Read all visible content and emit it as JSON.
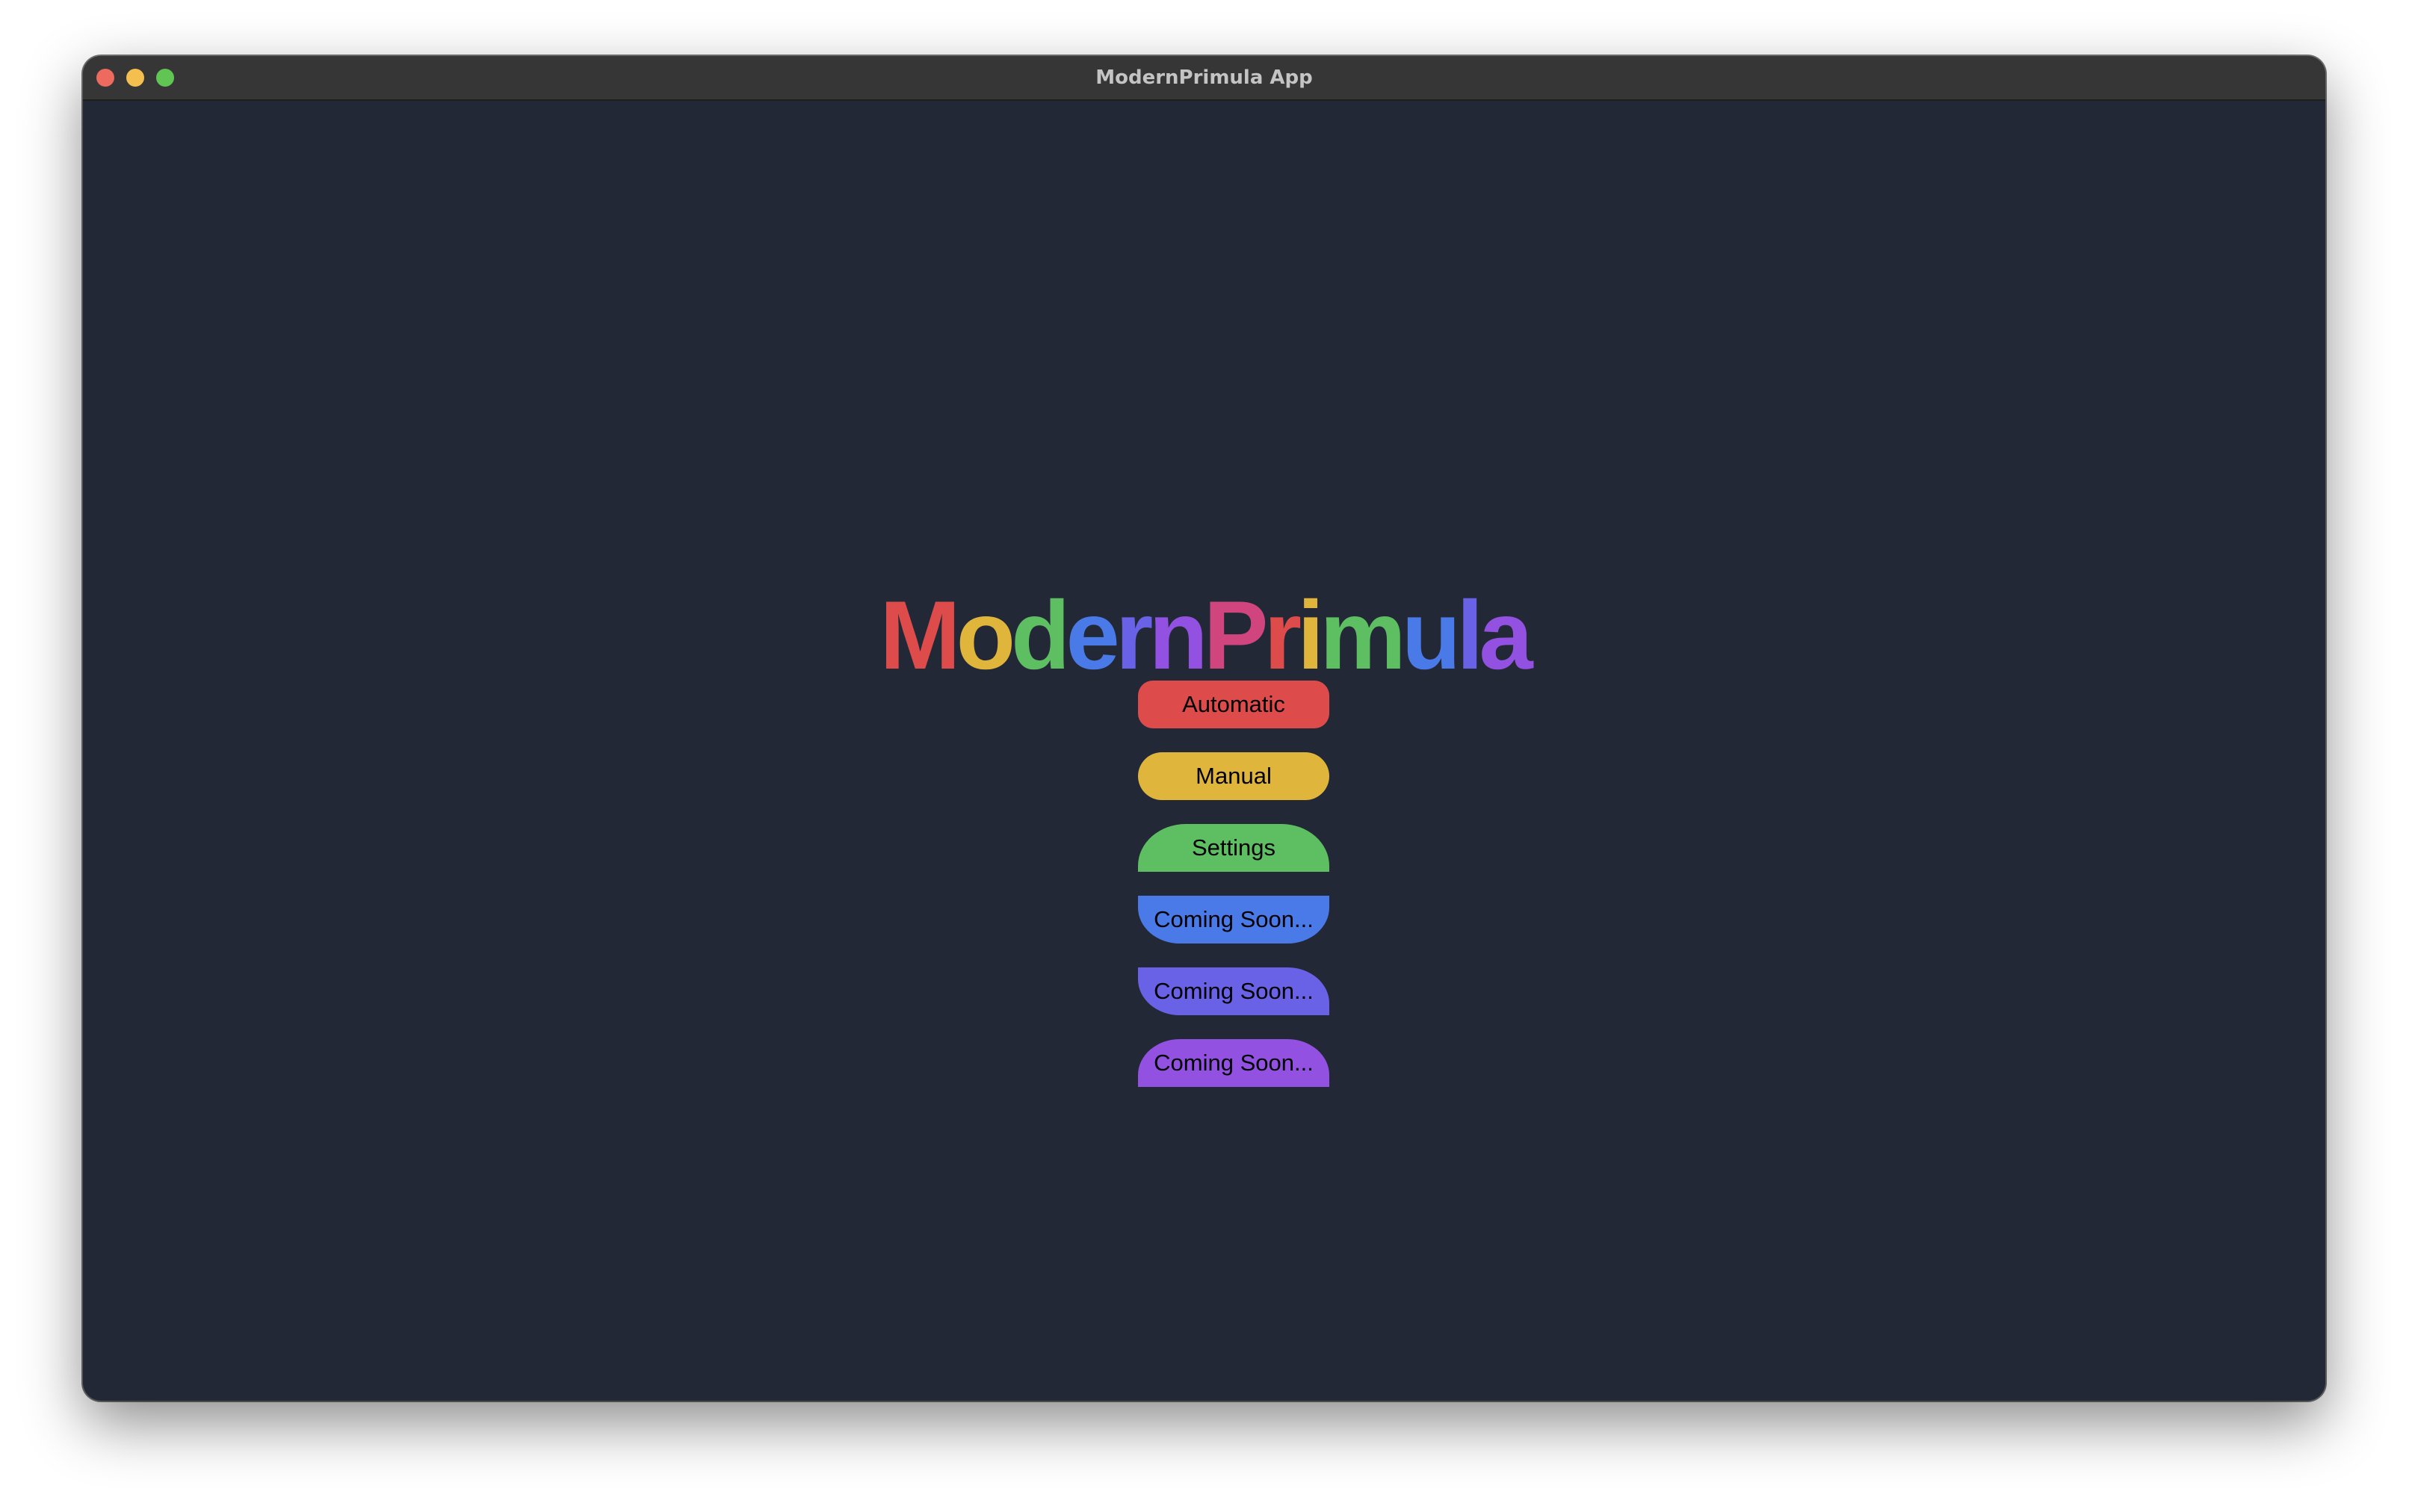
{
  "window": {
    "title": "ModernPrimula App",
    "controls": [
      {
        "name": "close",
        "color": "#ed6a5e"
      },
      {
        "name": "minimize",
        "color": "#f4bf4f"
      },
      {
        "name": "maximize",
        "color": "#61c554"
      }
    ],
    "background": "#222836"
  },
  "logo": {
    "text": "ModernPrimula",
    "letters": [
      {
        "char": "M",
        "color": "#de4b4b"
      },
      {
        "char": "o",
        "color": "#e0b53b"
      },
      {
        "char": "d",
        "color": "#5ebe62"
      },
      {
        "char": "e",
        "color": "#4a7ae8"
      },
      {
        "char": "r",
        "color": "#6a62e6"
      },
      {
        "char": "n",
        "color": "#9251e0"
      },
      {
        "char": "P",
        "color": "#d1457f"
      },
      {
        "char": "r",
        "color": "#de4b4b"
      },
      {
        "char": "i",
        "color": "#e0b53b"
      },
      {
        "char": "m",
        "color": "#5ebe62"
      },
      {
        "char": "u",
        "color": "#4a7ae8"
      },
      {
        "char": "l",
        "color": "#6a62e6"
      },
      {
        "char": "a",
        "color": "#9251e0"
      }
    ]
  },
  "menu": {
    "buttons": [
      {
        "label": "Automatic",
        "color": "#de4b4b"
      },
      {
        "label": "Manual",
        "color": "#e0b53b"
      },
      {
        "label": "Settings",
        "color": "#5ebe62"
      },
      {
        "label": "Coming Soon...",
        "color": "#4a7ae8"
      },
      {
        "label": "Coming Soon...",
        "color": "#6a62e6"
      },
      {
        "label": "Coming Soon...",
        "color": "#9251e0"
      }
    ]
  }
}
